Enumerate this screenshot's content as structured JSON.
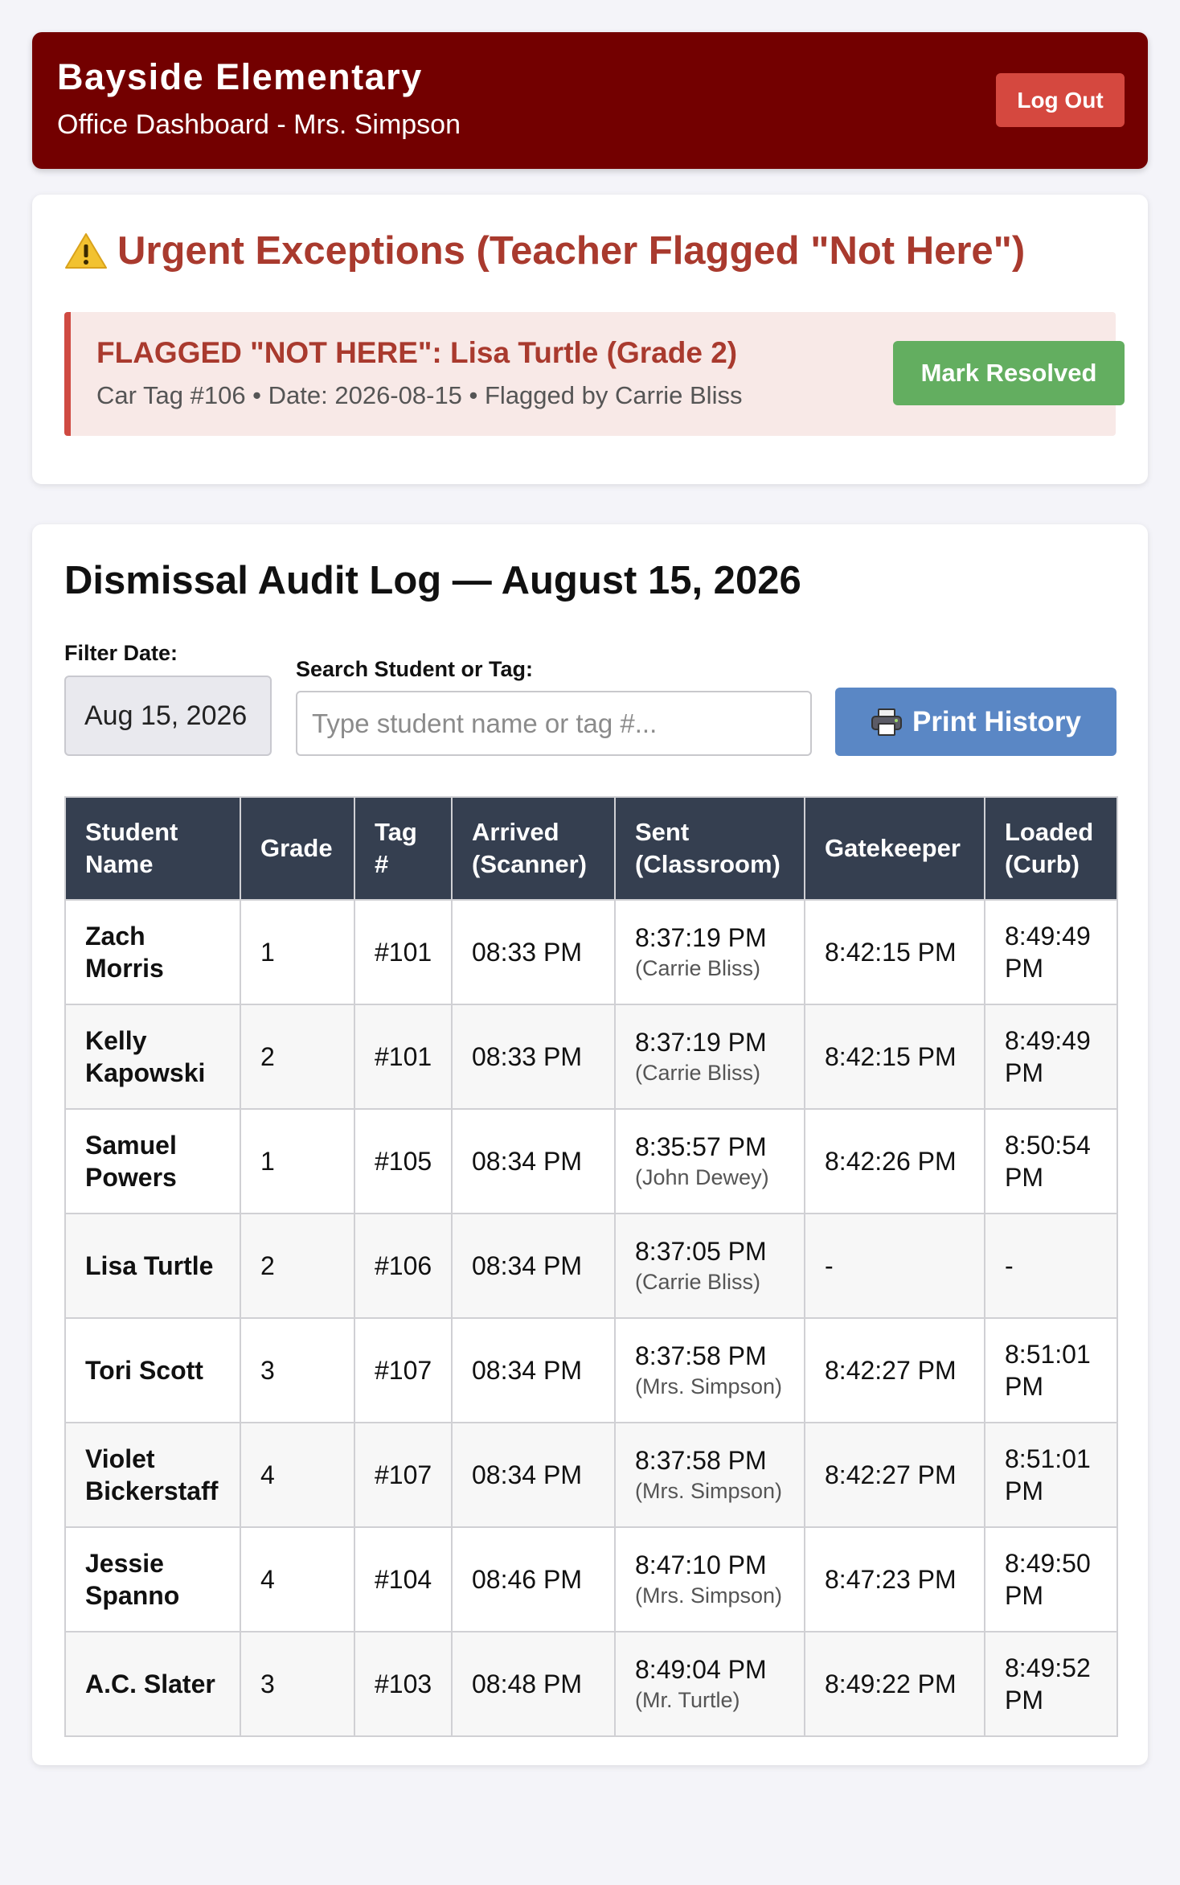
{
  "header": {
    "title": "Bayside Elementary",
    "subtitle": "Office Dashboard - Mrs. Simpson",
    "logout_label": "Log Out"
  },
  "exceptions": {
    "title": "Urgent Exceptions (Teacher Flagged \"Not Here\")",
    "icon": "warning-icon",
    "alert": {
      "title": "FLAGGED \"NOT HERE\": Lisa Turtle (Grade 2)",
      "meta": "Car Tag #106 • Date: 2026-08-15 • Flagged by Carrie Bliss",
      "resolve_label": "Mark Resolved"
    }
  },
  "audit": {
    "title": "Dismissal Audit Log — August 15, 2026",
    "filter_label": "Filter Date:",
    "filter_value": "Aug 15, 2026",
    "search_label": "Search Student or Tag:",
    "search_placeholder": "Type student name or tag #...",
    "search_value": "",
    "print_label": "Print History",
    "print_icon": "printer-icon",
    "columns": [
      "Student Name",
      "Grade",
      "Tag #",
      "Arrived (Scanner)",
      "Sent (Classroom)",
      "Gatekeeper",
      "Loaded (Curb)"
    ],
    "rows": [
      {
        "name": "Zach Morris",
        "grade": "1",
        "tag": "#101",
        "arrived": "08:33 PM",
        "sent": "8:37:19 PM",
        "sent_by": "(Carrie Bliss)",
        "gatekeeper": "8:42:15 PM",
        "loaded": "8:49:49 PM"
      },
      {
        "name": "Kelly Kapowski",
        "grade": "2",
        "tag": "#101",
        "arrived": "08:33 PM",
        "sent": "8:37:19 PM",
        "sent_by": "(Carrie Bliss)",
        "gatekeeper": "8:42:15 PM",
        "loaded": "8:49:49 PM"
      },
      {
        "name": "Samuel Powers",
        "grade": "1",
        "tag": "#105",
        "arrived": "08:34 PM",
        "sent": "8:35:57 PM",
        "sent_by": "(John Dewey)",
        "gatekeeper": "8:42:26 PM",
        "loaded": "8:50:54 PM"
      },
      {
        "name": "Lisa Turtle",
        "grade": "2",
        "tag": "#106",
        "arrived": "08:34 PM",
        "sent": "8:37:05 PM",
        "sent_by": "(Carrie Bliss)",
        "gatekeeper": "-",
        "loaded": "-"
      },
      {
        "name": "Tori Scott",
        "grade": "3",
        "tag": "#107",
        "arrived": "08:34 PM",
        "sent": "8:37:58 PM",
        "sent_by": "(Mrs. Simpson)",
        "gatekeeper": "8:42:27 PM",
        "loaded": "8:51:01 PM"
      },
      {
        "name": "Violet Bickerstaff",
        "grade": "4",
        "tag": "#107",
        "arrived": "08:34 PM",
        "sent": "8:37:58 PM",
        "sent_by": "(Mrs. Simpson)",
        "gatekeeper": "8:42:27 PM",
        "loaded": "8:51:01 PM"
      },
      {
        "name": "Jessie Spanno",
        "grade": "4",
        "tag": "#104",
        "arrived": "08:46 PM",
        "sent": "8:47:10 PM",
        "sent_by": "(Mrs. Simpson)",
        "gatekeeper": "8:47:23 PM",
        "loaded": "8:49:50 PM"
      },
      {
        "name": "A.C. Slater",
        "grade": "3",
        "tag": "#103",
        "arrived": "08:48 PM",
        "sent": "8:49:04 PM",
        "sent_by": "(Mr. Turtle)",
        "gatekeeper": "8:49:22 PM",
        "loaded": "8:49:52 PM"
      }
    ]
  },
  "colors": {
    "header_bg": "#730000",
    "danger": "#d5483f",
    "alert_text": "#a93a2e",
    "success": "#63ae60",
    "primary": "#5a87c5",
    "table_header": "#353f50"
  }
}
